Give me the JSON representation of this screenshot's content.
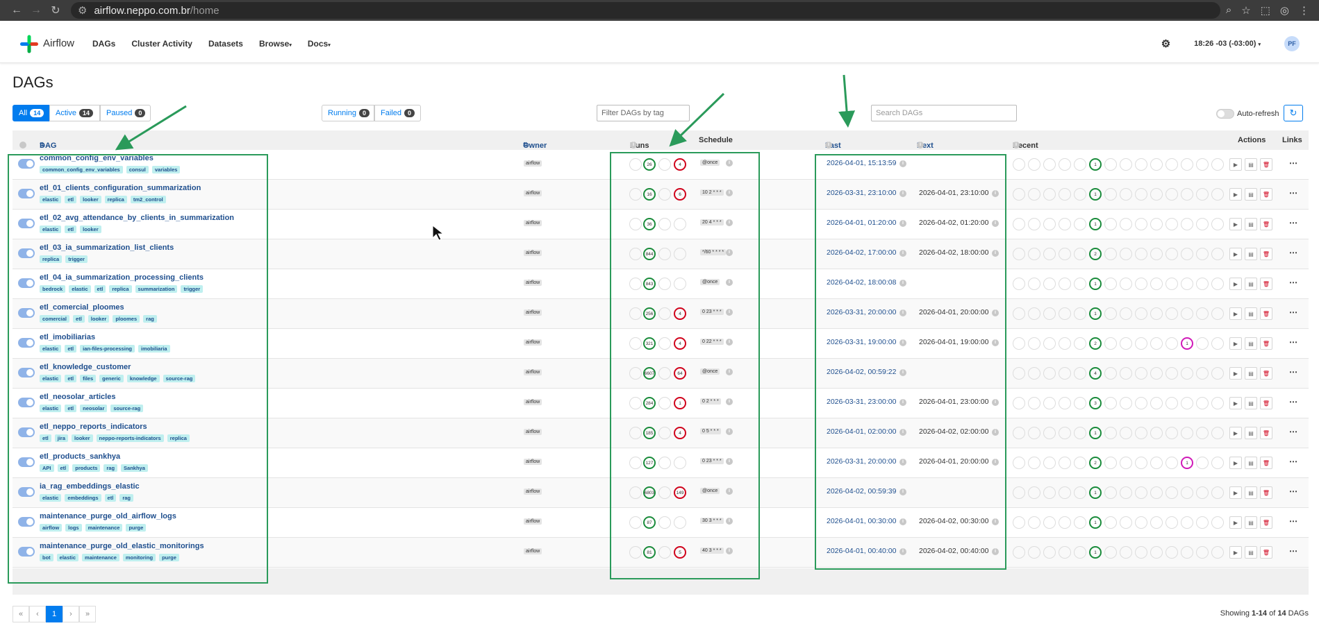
{
  "browser": {
    "url_host": "airflow.neppo.com.br",
    "url_path": "/home"
  },
  "navbar": {
    "brand": "Airflow",
    "items": [
      "DAGs",
      "Cluster Activity",
      "Datasets",
      "Browse",
      "Docs"
    ],
    "time": "18:26 -03 (-03:00)",
    "avatar": "PF"
  },
  "page": {
    "title": "DAGs",
    "filters": {
      "all_label": "All",
      "all_count": "14",
      "active_label": "Active",
      "active_count": "14",
      "paused_label": "Paused",
      "paused_count": "0",
      "running_label": "Running",
      "running_count": "0",
      "failed_label": "Failed",
      "failed_count": "0"
    },
    "tag_filter_placeholder": "Filter DAGs by tag",
    "search_placeholder": "Search DAGs",
    "auto_refresh": "Auto-refresh"
  },
  "columns": {
    "dag": "DAG",
    "owner": "Owner",
    "runs": "Runs",
    "schedule": "Schedule",
    "last_run": "Last Run",
    "next_run": "Next Run",
    "recent_tasks": "Recent Tasks",
    "actions": "Actions",
    "links": "Links"
  },
  "dags": [
    {
      "name": "common_config_env_variables",
      "tags": [
        "common_config_env_variables",
        "consul",
        "variables"
      ],
      "owner": "airflow",
      "success": "26",
      "failed": "4",
      "schedule": "@once",
      "last_run": "2026-04-01, 15:13:59",
      "next_run": "",
      "task_count": "1",
      "task_count2": ""
    },
    {
      "name": "etl_01_clients_configuration_summarization",
      "tags": [
        "elastic",
        "etl",
        "looker",
        "replica",
        "tm2_control"
      ],
      "owner": "airflow",
      "success": "16",
      "failed": "6",
      "schedule": "10 2 * * *",
      "last_run": "2026-03-31, 23:10:00",
      "next_run": "2026-04-01, 23:10:00",
      "task_count": "1",
      "task_count2": ""
    },
    {
      "name": "etl_02_avg_attendance_by_clients_in_summarization",
      "tags": [
        "elastic",
        "etl",
        "looker"
      ],
      "owner": "airflow",
      "success": "36",
      "failed": "",
      "schedule": "20 4 * * *",
      "last_run": "2026-04-01, 01:20:00",
      "next_run": "2026-04-02, 01:20:00",
      "task_count": "1",
      "task_count2": ""
    },
    {
      "name": "etl_03_ia_summarization_list_clients",
      "tags": [
        "replica",
        "trigger"
      ],
      "owner": "airflow",
      "success": "844",
      "failed": "",
      "schedule": "*/60 * * * *",
      "last_run": "2026-04-02, 17:00:00",
      "next_run": "2026-04-02, 18:00:00",
      "task_count": "2",
      "task_count2": ""
    },
    {
      "name": "etl_04_ia_summarization_processing_clients",
      "tags": [
        "bedrock",
        "elastic",
        "etl",
        "replica",
        "summarization",
        "trigger"
      ],
      "owner": "airflow",
      "success": "843",
      "failed": "",
      "schedule": "@once",
      "last_run": "2026-04-02, 18:00:08",
      "next_run": "",
      "task_count": "1",
      "task_count2": ""
    },
    {
      "name": "etl_comercial_ploomes",
      "tags": [
        "comercial",
        "etl",
        "looker",
        "ploomes",
        "rag"
      ],
      "owner": "airflow",
      "success": "256",
      "failed": "4",
      "schedule": "0 23 * * *",
      "last_run": "2026-03-31, 20:00:00",
      "next_run": "2026-04-01, 20:00:00",
      "task_count": "1",
      "task_count2": ""
    },
    {
      "name": "etl_imobiliarias",
      "tags": [
        "elastic",
        "etl",
        "ian-files-processing",
        "imobiliaria"
      ],
      "owner": "airflow",
      "success": "321",
      "failed": "4",
      "schedule": "0 22 * * *",
      "last_run": "2026-03-31, 19:00:00",
      "next_run": "2026-04-01, 19:00:00",
      "task_count": "2",
      "task_count2": "1"
    },
    {
      "name": "etl_knowledge_customer",
      "tags": [
        "elastic",
        "etl",
        "files",
        "generic",
        "knowledge",
        "source-rag"
      ],
      "owner": "airflow",
      "success": "6607",
      "failed": "64",
      "schedule": "@once",
      "last_run": "2026-04-02, 00:59:22",
      "next_run": "",
      "task_count": "4",
      "task_count2": ""
    },
    {
      "name": "etl_neosolar_articles",
      "tags": [
        "elastic",
        "etl",
        "neosolar",
        "source-rag"
      ],
      "owner": "airflow",
      "success": "284",
      "failed": "1",
      "schedule": "0 2 * * *",
      "last_run": "2026-03-31, 23:00:00",
      "next_run": "2026-04-01, 23:00:00",
      "task_count": "3",
      "task_count2": ""
    },
    {
      "name": "etl_neppo_reports_indicators",
      "tags": [
        "etl",
        "jira",
        "looker",
        "neppo-reports-indicators",
        "replica"
      ],
      "owner": "airflow",
      "success": "185",
      "failed": "4",
      "schedule": "0 5 * * *",
      "last_run": "2026-04-01, 02:00:00",
      "next_run": "2026-04-02, 02:00:00",
      "task_count": "1",
      "task_count2": ""
    },
    {
      "name": "etl_products_sankhya",
      "tags": [
        "API",
        "etl",
        "products",
        "rag",
        "Sankhya"
      ],
      "owner": "airflow",
      "success": "127",
      "failed": "",
      "schedule": "0 23 * * *",
      "last_run": "2026-03-31, 20:00:00",
      "next_run": "2026-04-01, 20:00:00",
      "task_count": "2",
      "task_count2": "1"
    },
    {
      "name": "ia_rag_embeddings_elastic",
      "tags": [
        "elastic",
        "embeddings",
        "etl",
        "rag"
      ],
      "owner": "airflow",
      "success": "6803",
      "failed": "149",
      "schedule": "@once",
      "last_run": "2026-04-02, 00:59:39",
      "next_run": "",
      "task_count": "1",
      "task_count2": ""
    },
    {
      "name": "maintenance_purge_old_airflow_logs",
      "tags": [
        "airflow",
        "logs",
        "maintenance",
        "purge"
      ],
      "owner": "airflow",
      "success": "87",
      "failed": "",
      "schedule": "30 3 * * *",
      "last_run": "2026-04-01, 00:30:00",
      "next_run": "2026-04-02, 00:30:00",
      "task_count": "1",
      "task_count2": ""
    },
    {
      "name": "maintenance_purge_old_elastic_monitorings",
      "tags": [
        "bot",
        "elastic",
        "maintenance",
        "monitoring",
        "purge"
      ],
      "owner": "airflow",
      "success": "81",
      "failed": "5",
      "schedule": "40 3 * * *",
      "last_run": "2026-04-01, 00:40:00",
      "next_run": "2026-04-02, 00:40:00",
      "task_count": "1",
      "task_count2": ""
    }
  ],
  "pagination": {
    "first": "«",
    "prev": "‹",
    "current": "1",
    "next": "›",
    "last": "»"
  },
  "footer": {
    "prefix": "Showing ",
    "range": "1-14",
    "suffix": " of ",
    "total": "14",
    "unit": " DAGs"
  },
  "colors": {
    "accent": "#017cee",
    "annotation_green": "#2a9a5a",
    "success": "#1a8b3b",
    "failed": "#d0021b"
  },
  "icons": [
    "back-arrow-icon",
    "forward-arrow-icon",
    "reload-icon",
    "site-settings-icon",
    "zoom-icon",
    "star-icon",
    "extensions-icon",
    "profile-icon",
    "menu-icon",
    "gear-icon",
    "play-icon",
    "code-icon",
    "trash-icon",
    "ellipsis-icon",
    "info-icon",
    "sort-icon"
  ]
}
